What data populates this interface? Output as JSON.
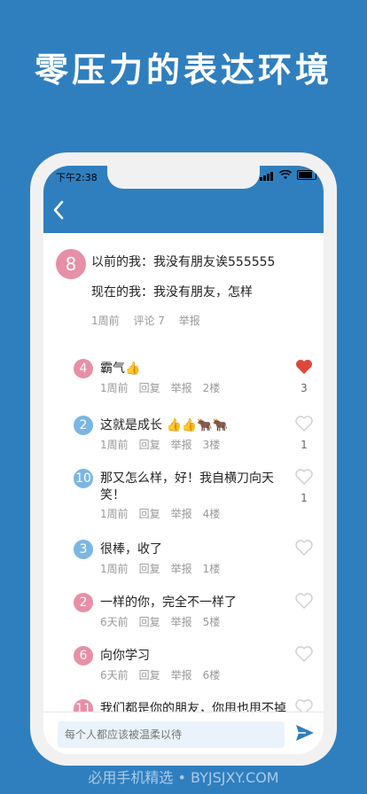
{
  "headline": "零压力的表达环境",
  "status_bar": {
    "time": "下午2:38"
  },
  "post": {
    "avatar_number": "8",
    "line1": "以前的我：我没有朋友诶555555",
    "line2": "现在的我：我没有朋友，怎样",
    "time": "1周前",
    "comments": "评论 7",
    "report": "举报"
  },
  "replies": [
    {
      "avatar": "4",
      "color": "#e78fa6",
      "text": "霸气👍",
      "time": "1周前",
      "reply": "回复",
      "report": "举报",
      "floor": "2楼",
      "liked": true,
      "likes": "3"
    },
    {
      "avatar": "2",
      "color": "#7bb6e3",
      "text": "这就是成长 👍👍🐂🐂",
      "time": "1周前",
      "reply": "回复",
      "report": "举报",
      "floor": "3楼",
      "liked": false,
      "likes": "1"
    },
    {
      "avatar": "10",
      "color": "#7bb6e3",
      "text": "那又怎么样，好！我自横刀向天笑！",
      "time": "1周前",
      "reply": "回复",
      "report": "举报",
      "floor": "4楼",
      "liked": false,
      "likes": "1"
    },
    {
      "avatar": "3",
      "color": "#7bb6e3",
      "text": "很棒，收了",
      "time": "1周前",
      "reply": "回复",
      "report": "举报",
      "floor": "1楼",
      "liked": false,
      "likes": ""
    },
    {
      "avatar": "2",
      "color": "#e78fa6",
      "text": "一样的你，完全不一样了",
      "time": "6天前",
      "reply": "回复",
      "report": "举报",
      "floor": "5楼",
      "liked": false,
      "likes": ""
    },
    {
      "avatar": "6",
      "color": "#e78fa6",
      "text": "向你学习",
      "time": "6天前",
      "reply": "回复",
      "report": "举报",
      "floor": "6楼",
      "liked": false,
      "likes": ""
    },
    {
      "avatar": "11",
      "color": "#e78fa6",
      "text": "我们都是你的朋友，你甩也甩不掉🐔",
      "time": "",
      "reply": "",
      "report": "",
      "floor": "",
      "liked": false,
      "likes": ""
    }
  ],
  "input": {
    "placeholder": "每个人都应该被温柔以待"
  },
  "watermark": "必用手机精选 • BYJSJXY.COM"
}
